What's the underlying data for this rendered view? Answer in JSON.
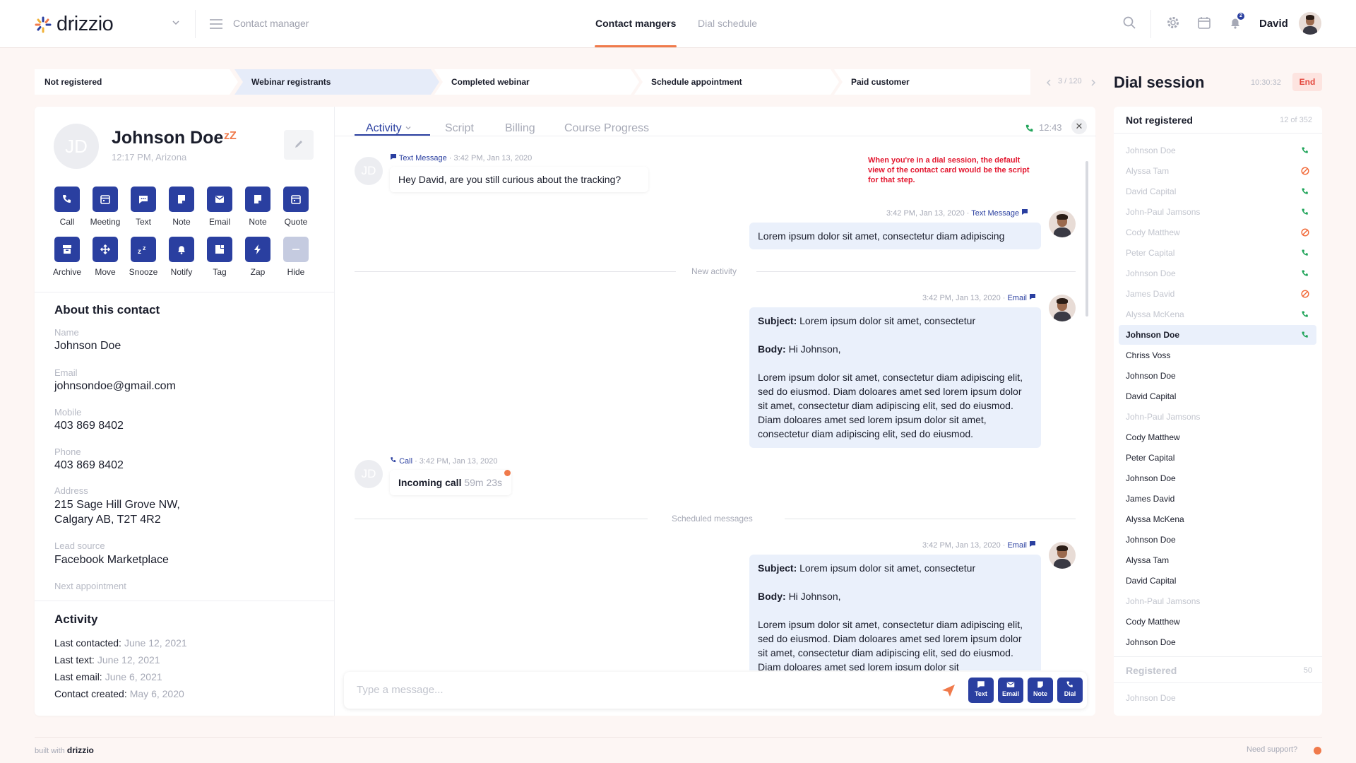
{
  "brand": {
    "name": "drizzio"
  },
  "header": {
    "menu_title": "Contact manager",
    "tabs": [
      {
        "label": "Contact mangers",
        "active": true
      },
      {
        "label": "Dial schedule",
        "active": false
      }
    ],
    "notification_count": "2",
    "user_name": "David"
  },
  "pipeline": {
    "stages": [
      "Not registered",
      "Webinar registrants",
      "Completed webinar",
      "Schedule appointment",
      "Paid customer"
    ],
    "active_stage": 1,
    "pager": "3 / 120"
  },
  "dial_session": {
    "title": "Dial session",
    "timer": "10:30:32",
    "end_label": "End"
  },
  "contact": {
    "initials": "JD",
    "name": "Johnson Doe",
    "snooze_glyph": "zZ",
    "subtitle": "12:17 PM, Arizona",
    "actions_row1": [
      {
        "label": "Call",
        "icon": "phone-icon"
      },
      {
        "label": "Meeting",
        "icon": "calendar-icon"
      },
      {
        "label": "Text",
        "icon": "message-icon"
      },
      {
        "label": "Note",
        "icon": "note-icon"
      },
      {
        "label": "Email",
        "icon": "mail-icon"
      },
      {
        "label": "Note",
        "icon": "note-icon"
      },
      {
        "label": "Quote",
        "icon": "calendar-icon"
      }
    ],
    "actions_row2": [
      {
        "label": "Archive",
        "icon": "archive-icon"
      },
      {
        "label": "Move",
        "icon": "move-icon"
      },
      {
        "label": "Snooze",
        "icon": "snooze-icon"
      },
      {
        "label": "Notify",
        "icon": "bell-icon"
      },
      {
        "label": "Tag",
        "icon": "tag-icon"
      },
      {
        "label": "Zap",
        "icon": "bolt-icon"
      },
      {
        "label": "Hide",
        "icon": "minus-icon"
      }
    ]
  },
  "about": {
    "title": "About this contact",
    "fields": [
      {
        "label": "Name",
        "value": "Johnson Doe"
      },
      {
        "label": "Email",
        "value": "johnsondoe@gmail.com"
      },
      {
        "label": "Mobile",
        "value": "403 869 8402"
      },
      {
        "label": "Phone",
        "value": "403 869 8402"
      },
      {
        "label": "Address",
        "value": "215 Sage Hill Grove NW,",
        "value2": "Calgary AB, T2T 4R2"
      },
      {
        "label": "Lead source",
        "value": "Facebook Marketplace"
      },
      {
        "label": "Next appointment",
        "value": ""
      }
    ]
  },
  "activity_summary": {
    "title": "Activity",
    "rows": [
      {
        "label": "Last contacted:",
        "value": "June 12, 2021"
      },
      {
        "label": "Last text:",
        "value": "June 12, 2021"
      },
      {
        "label": "Last email:",
        "value": "June 6, 2021"
      },
      {
        "label": "Contact created:",
        "value": "May 6, 2020"
      }
    ]
  },
  "tabs": {
    "items": [
      "Activity",
      "Script",
      "Billing",
      "Course Progress"
    ],
    "active": 0,
    "call_timer": "12:43"
  },
  "annotation": "When you're in a dial session, the default view of the contact card would be the script for that step.",
  "feed": {
    "msg1": {
      "kind": "Text Message",
      "time": "3:42 PM, Jan 13, 2020",
      "text": "Hey David, are you still curious about the tracking?"
    },
    "msg2": {
      "kind": "Text Message",
      "time": "3:42 PM, Jan 13, 2020",
      "text": "Lorem ipsum dolor sit amet, consectetur diam adipiscing"
    },
    "sep1": "New activity",
    "msg3": {
      "kind": "Email",
      "time": "3:42 PM, Jan 13, 2020",
      "subject_label": "Subject:",
      "subject": "Lorem ipsum dolor sit amet, consectetur",
      "body_label": "Body:",
      "greeting": "Hi Johnson,",
      "body": "Lorem ipsum dolor sit amet, consectetur diam adipiscing elit, sed do eiusmod. Diam doloares amet sed lorem ipsum dolor sit amet, consectetur diam adipiscing elit, sed do eiusmod. Diam doloares amet sed lorem ipsum dolor sit amet, consectetur diam adipiscing elit, sed do eiusmod."
    },
    "msg4": {
      "kind": "Call",
      "time": "3:42 PM, Jan 13, 2020",
      "label": "Incoming call",
      "duration": "59m 23s"
    },
    "sep2": "Scheduled messages",
    "msg5": {
      "kind": "Email",
      "time": "3:42 PM, Jan 13, 2020",
      "subject_label": "Subject:",
      "subject": "Lorem ipsum dolor sit amet, consectetur",
      "body_label": "Body:",
      "greeting": "Hi Johnson,",
      "body": "Lorem ipsum dolor sit amet, consectetur diam adipiscing elit, sed do eiusmod. Diam doloares amet sed lorem ipsum dolor sit amet, consectetur diam adipiscing elit, sed do eiusmod. Diam doloares amet sed lorem ipsum dolor sit"
    }
  },
  "composer": {
    "placeholder": "Type a message...",
    "buttons": [
      "Text",
      "Email",
      "Note",
      "Dial"
    ]
  },
  "session_list": {
    "group1": {
      "title": "Not registered",
      "count": "12 of 352"
    },
    "items": [
      {
        "name": "Johnson Doe",
        "state": "done",
        "status": "call"
      },
      {
        "name": "Alyssa Tam",
        "state": "done",
        "status": "blocked"
      },
      {
        "name": "David Capital",
        "state": "done",
        "status": "call"
      },
      {
        "name": "John-Paul Jamsons",
        "state": "done",
        "status": "call"
      },
      {
        "name": "Cody Matthew",
        "state": "done",
        "status": "blocked"
      },
      {
        "name": "Peter Capital",
        "state": "done",
        "status": "call"
      },
      {
        "name": "Johnson Doe",
        "state": "done",
        "status": "call"
      },
      {
        "name": "James David",
        "state": "done",
        "status": "blocked"
      },
      {
        "name": "Alyssa McKena",
        "state": "done",
        "status": "call"
      },
      {
        "name": "Johnson Doe",
        "state": "current",
        "status": "call"
      },
      {
        "name": "Chriss Voss",
        "state": "pending",
        "status": ""
      },
      {
        "name": "Johnson Doe",
        "state": "pending",
        "status": ""
      },
      {
        "name": "David Capital",
        "state": "pending",
        "status": ""
      },
      {
        "name": "John-Paul Jamsons",
        "state": "done",
        "status": ""
      },
      {
        "name": "Cody Matthew",
        "state": "pending",
        "status": ""
      },
      {
        "name": "Peter Capital",
        "state": "pending",
        "status": ""
      },
      {
        "name": "Johnson Doe",
        "state": "pending",
        "status": ""
      },
      {
        "name": "James David",
        "state": "pending",
        "status": ""
      },
      {
        "name": "Alyssa McKena",
        "state": "pending",
        "status": ""
      },
      {
        "name": "Johnson Doe",
        "state": "pending",
        "status": ""
      },
      {
        "name": "Alyssa Tam",
        "state": "pending",
        "status": ""
      },
      {
        "name": "David Capital",
        "state": "pending",
        "status": ""
      },
      {
        "name": "John-Paul Jamsons",
        "state": "done",
        "status": ""
      },
      {
        "name": "Cody Matthew",
        "state": "pending",
        "status": ""
      },
      {
        "name": "Johnson Doe",
        "state": "pending",
        "status": ""
      }
    ],
    "group2": {
      "title": "Registered",
      "count": "50"
    },
    "group2_first": "Johnson Doe"
  },
  "footer": {
    "built_with": "built with",
    "brand": "drizzio",
    "support": "Need support?"
  },
  "colors": {
    "primary": "#2a3fa0",
    "accent": "#f07a4b",
    "call_green": "#22a55b",
    "blocked_orange": "#f26b3a",
    "danger": "#e3463c"
  }
}
